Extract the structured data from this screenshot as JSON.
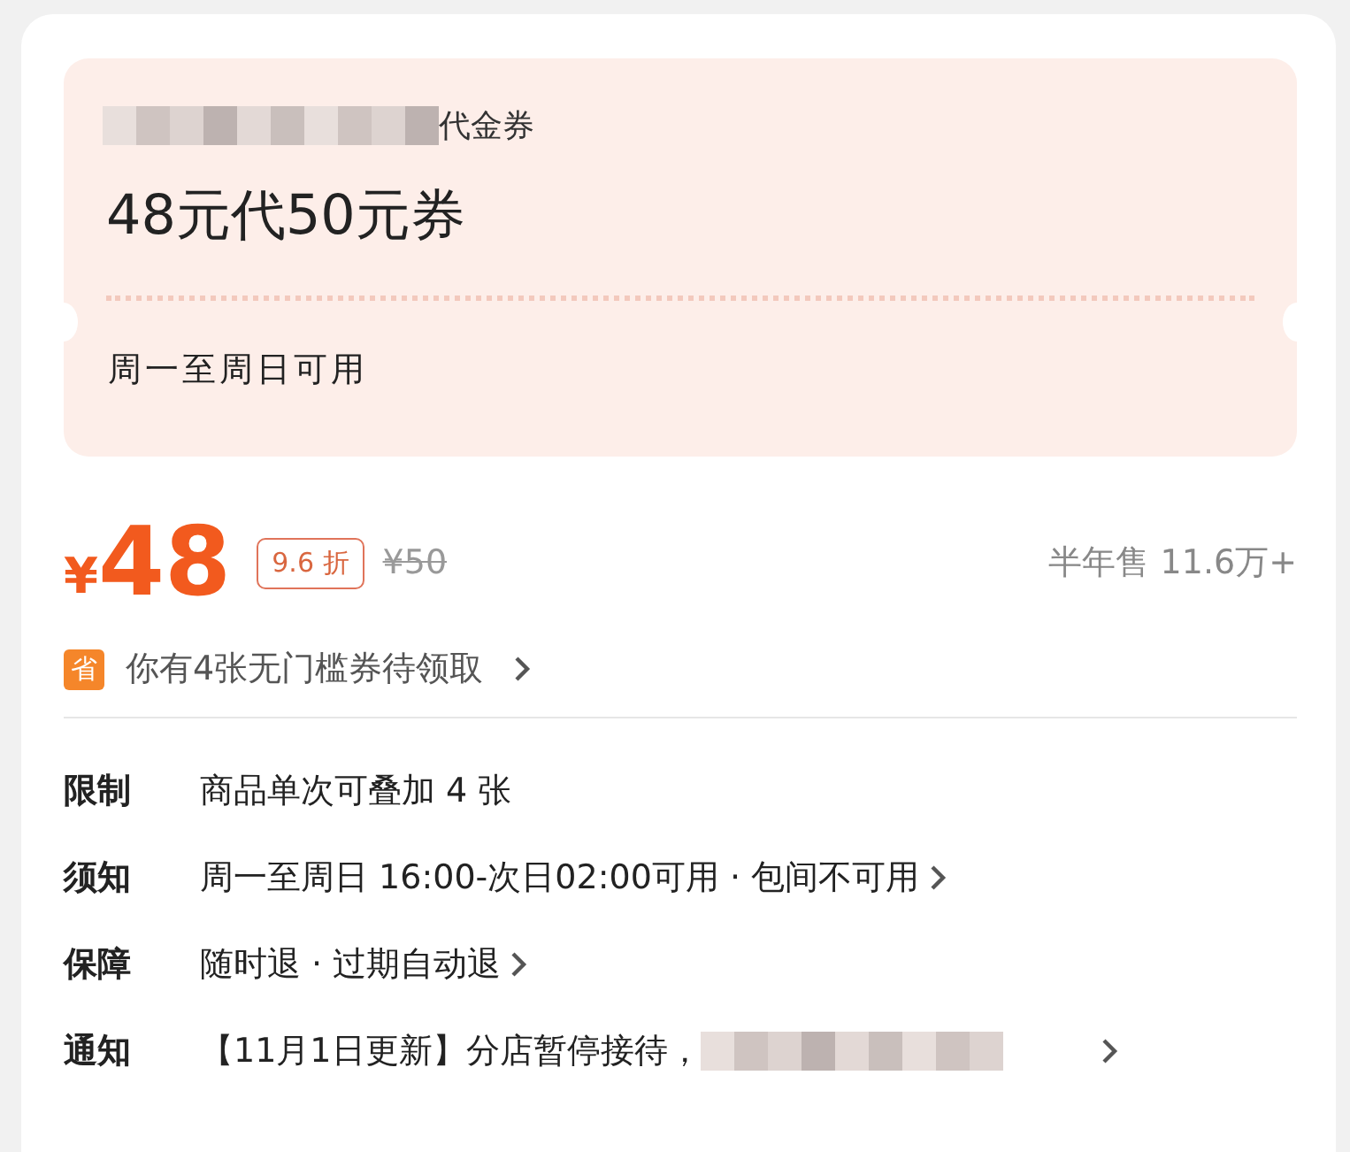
{
  "coupon": {
    "subtitle_suffix": "代金券",
    "subtitle_redacted": true,
    "title": "48元代50元券",
    "validity": "周一至周日可用"
  },
  "price": {
    "currency": "¥",
    "amount": "48",
    "discount": "9.6 折",
    "original": "¥50",
    "sales": "半年售 11.6万+"
  },
  "saving": {
    "icon_text": "省",
    "text": "你有4张无门槛券待领取"
  },
  "details": [
    {
      "label": "限制",
      "text": "商品单次可叠加 4 张",
      "arrow": false,
      "redacted": false
    },
    {
      "label": "须知",
      "text": "周一至周日 16:00-次日02:00可用 · 包间不可用",
      "arrow": true,
      "redacted": false
    },
    {
      "label": "保障",
      "text": "随时退 · 过期自动退",
      "arrow": true,
      "redacted": false
    },
    {
      "label": "通知",
      "text": "【11月1日更新】分店暂停接待，",
      "arrow": true,
      "redacted": true
    }
  ]
}
